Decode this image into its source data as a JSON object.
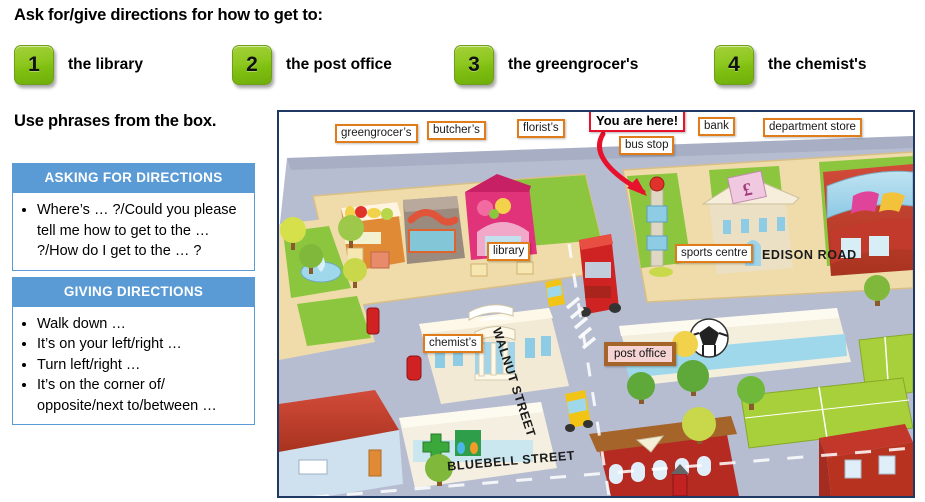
{
  "header": {
    "title": "Ask for/give directions for how to get to:",
    "tasks": [
      {
        "num": "1",
        "label": "the library"
      },
      {
        "num": "2",
        "label": "the post office"
      },
      {
        "num": "3",
        "label": "the greengrocer's"
      },
      {
        "num": "4",
        "label": "the chemist's"
      }
    ]
  },
  "subtitle": "Use phrases from the box.",
  "phrase_box": {
    "asking": {
      "header": "ASKING FOR DIRECTIONS",
      "items": [
        "Where’s … ?/Could you please tell me how to get to the … ?/How do I get to the … ?"
      ]
    },
    "giving": {
      "header": "GIVING DIRECTIONS",
      "items": [
        "Walk down …",
        "It’s on your left/right …",
        "Turn left/right …",
        "It’s on the corner of/ opposite/next to/between …"
      ]
    }
  },
  "map": {
    "callout": "You are here!",
    "place_labels": [
      {
        "name": "greengrocers",
        "text": "greengrocer’s"
      },
      {
        "name": "butchers",
        "text": "butcher’s"
      },
      {
        "name": "florists",
        "text": "florist’s"
      },
      {
        "name": "bus-stop",
        "text": "bus stop"
      },
      {
        "name": "bank",
        "text": "bank"
      },
      {
        "name": "department-store",
        "text": "department store"
      },
      {
        "name": "library",
        "text": "library"
      },
      {
        "name": "sports-centre",
        "text": "sports centre"
      },
      {
        "name": "chemists",
        "text": "chemist’s"
      },
      {
        "name": "post-office",
        "text": "post office"
      }
    ],
    "streets": [
      {
        "name": "edison-road",
        "text": "EDISON ROAD"
      },
      {
        "name": "walnut-street",
        "text": "WALNUT STREET"
      },
      {
        "name": "bluebell-street",
        "text": "BLUEBELL STREET"
      }
    ],
    "colors": {
      "frame_border": "#1f3864",
      "label_border": "#e07c1a",
      "callout_border": "#e8112d",
      "road": "#b7bdd1",
      "pavement": "#f0dcac",
      "grass": "#8cc63f"
    }
  },
  "colors": {
    "accent_blue": "#5b9bd5",
    "button_green": "#8ec820"
  }
}
